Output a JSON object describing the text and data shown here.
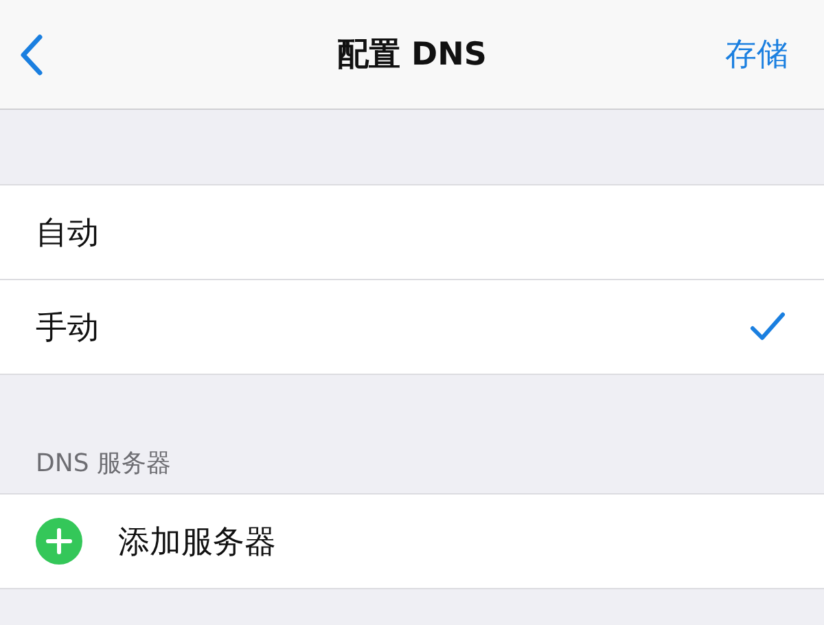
{
  "nav": {
    "title": "配置 DNS",
    "action": "存储"
  },
  "modes": [
    {
      "label": "自动",
      "selected": false
    },
    {
      "label": "手动",
      "selected": true
    }
  ],
  "servers": {
    "header": "DNS 服务器",
    "add_label": "添加服务器"
  }
}
